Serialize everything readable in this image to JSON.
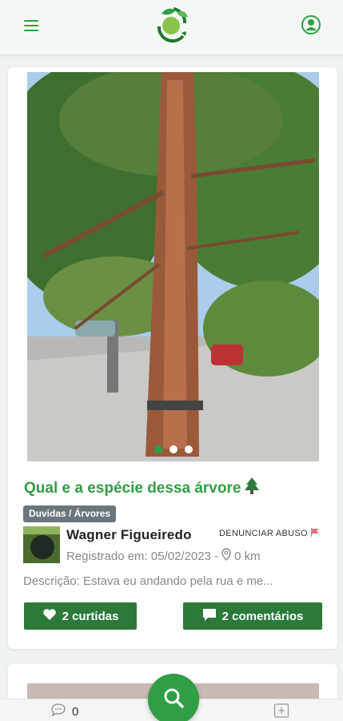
{
  "header": {
    "menu_icon": "hamburger-menu-icon",
    "logo_icon": "leaf-recycle-logo",
    "profile_icon": "user-circle-icon",
    "accent_color": "#2f9e44"
  },
  "post": {
    "title": "Qual e a espécie dessa árvore",
    "title_icon": "tree-icon",
    "category": "Duvidas / Árvores",
    "author": "Wagner Figueiredo",
    "report_label": "DENUNCIAR ABUSO",
    "report_icon": "flag-icon",
    "registered": "Registrado em: 05/02/2023 -",
    "distance": "0 km",
    "description": "Descrição: Estava eu andando pela rua e me...",
    "likes_label": "2 curtidas",
    "comments_label": "2 comentários",
    "image_count": 3,
    "active_image": 1
  },
  "bottom_nav": {
    "chat_count": "0",
    "chat_icon": "chat-bubble-icon",
    "search_icon": "search-icon",
    "add_icon": "plus-square-icon"
  }
}
